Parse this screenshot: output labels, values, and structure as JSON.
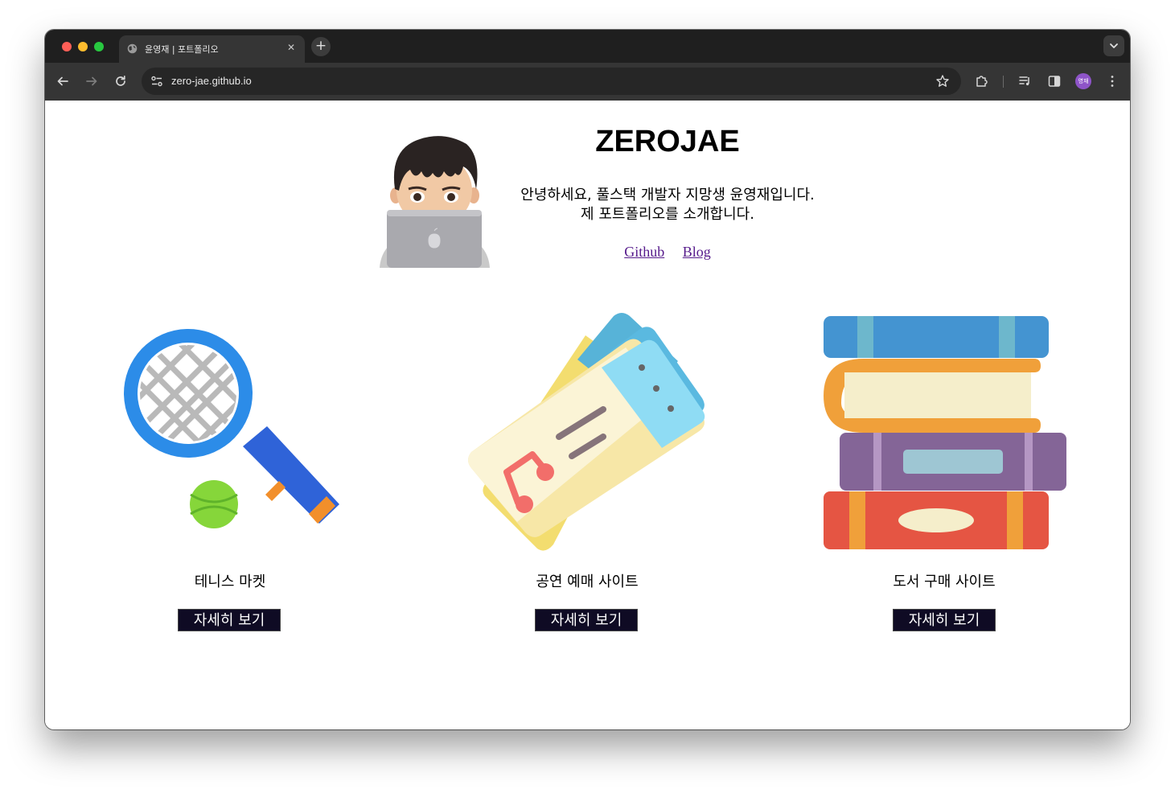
{
  "browser": {
    "tab_title": "윤영재 | 포트폴리오",
    "tab_close": "✕",
    "new_tab": "+",
    "url": "zero-jae.github.io",
    "profile_initials": "영재"
  },
  "hero": {
    "title": "ZEROJAE",
    "intro_line1": "안녕하세요, 풀스택 개발자 지망생 윤영재입니다.",
    "intro_line2": "제 포트폴리오를 소개합니다.",
    "link_github": "Github",
    "link_blog": "Blog"
  },
  "projects": [
    {
      "label": "테니스 마켓",
      "button": "자세히 보기",
      "icon": "tennis-racket-icon"
    },
    {
      "label": "공연 예매 사이트",
      "button": "자세히 보기",
      "icon": "music-ticket-icon"
    },
    {
      "label": "도서 구매 사이트",
      "button": "자세히 보기",
      "icon": "book-stack-icon"
    }
  ],
  "colors": {
    "button_bg": "#0f0b24",
    "link": "#551a8b",
    "window_chrome": "#1f1f1f"
  }
}
